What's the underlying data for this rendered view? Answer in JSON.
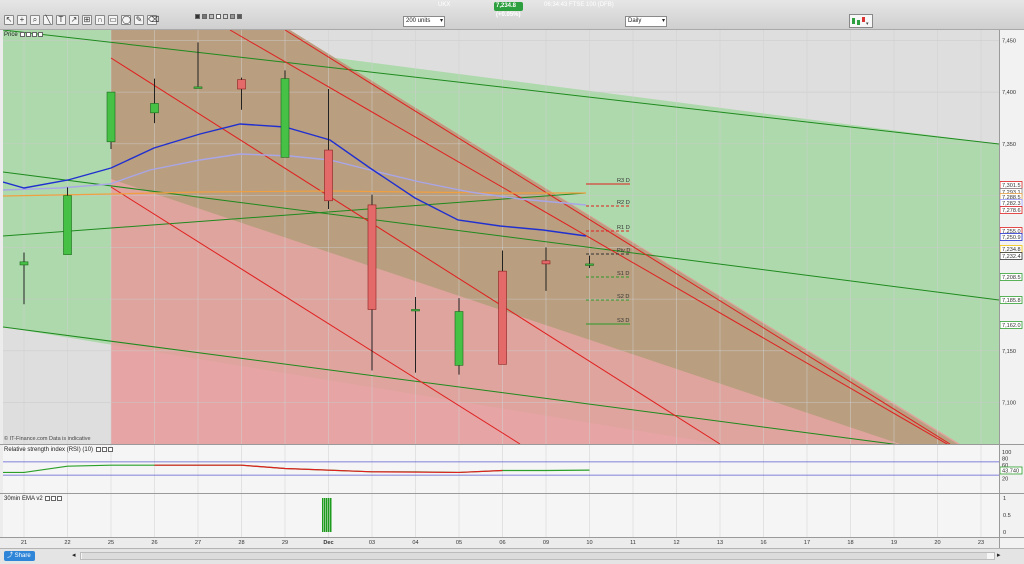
{
  "toolbar": {
    "ticker": "UKX",
    "price_change": "7,234.8 (+0.05%)",
    "time_info": "06:34:43 FTSE 100 (DFB)",
    "units_select": "200 units",
    "interval_select": "Daily",
    "tools": [
      "pointer-icon",
      "crosshair-icon",
      "zoom-icon",
      "line-icon",
      "text-icon",
      "trend-icon",
      "measure-icon",
      "magnet-icon",
      "rect-icon",
      "ellipse-icon",
      "draw-icon",
      "eraser-icon"
    ],
    "swatches": [
      "#333333",
      "#777777",
      "#bbbbbb",
      "#ffffff",
      "#d9d9d9",
      "#9a9a9a",
      "#5a5a5a"
    ]
  },
  "price_panel": {
    "title": "Price",
    "footer": "© IT-Finance.com  Data is indicative",
    "y_ticks": [
      "7,450",
      "7,400",
      "7,350",
      "7,300",
      "7,250",
      "7,200",
      "7,150",
      "7,100"
    ],
    "price_tags": [
      {
        "label": "7,301.5",
        "color": "#e02020"
      },
      {
        "label": "7,293.1",
        "color": "#888888"
      },
      {
        "label": "7,288.5",
        "color": "#e8a040"
      },
      {
        "label": "7,282.3",
        "color": "#9999ff"
      },
      {
        "label": "7,278.6",
        "color": "#e02020"
      },
      {
        "label": "7,255.0",
        "color": "#e02020"
      },
      {
        "label": "7,250.9",
        "color": "#2030d0"
      },
      {
        "label": "7,234.8",
        "color": "#f2c200"
      },
      {
        "label": "7,232.4",
        "color": "#333333"
      },
      {
        "label": "7,208.5",
        "color": "#30a030"
      },
      {
        "label": "7,185.8",
        "color": "#30a030"
      },
      {
        "label": "7,162.0",
        "color": "#30a030"
      }
    ],
    "pivots": [
      {
        "label": "R3 D",
        "color": "#e02020"
      },
      {
        "label": "R2 D",
        "color": "#e02020"
      },
      {
        "label": "R1 D",
        "color": "#e02020"
      },
      {
        "label": "Piv D",
        "color": "#333333"
      },
      {
        "label": "S1 D",
        "color": "#2a9a2a"
      },
      {
        "label": "S2 D",
        "color": "#2a9a2a"
      },
      {
        "label": "S3 D",
        "color": "#2a9a2a"
      }
    ]
  },
  "rsi_panel": {
    "title": "Relative strength index (RSI) (10)",
    "y_ticks": [
      "100",
      "80",
      "60",
      "40",
      "20"
    ],
    "current": "43.740"
  },
  "ema_panel": {
    "title": "30min EMA v2",
    "y_ticks": [
      "1",
      "0.5",
      "0"
    ]
  },
  "x_axis": [
    "21",
    "22",
    "25",
    "26",
    "27",
    "28",
    "29",
    "Dec",
    "03",
    "04",
    "05",
    "06",
    "09",
    "10",
    "11",
    "12",
    "13",
    "16",
    "17",
    "18",
    "19",
    "20",
    "23"
  ],
  "bottom": {
    "share": "Share"
  },
  "chart_data": {
    "type": "candlestick",
    "interval": "Daily",
    "ylim": [
      7060,
      7460
    ],
    "dates": [
      "21",
      "22",
      "25",
      "26",
      "27",
      "28",
      "29",
      "Dec",
      "03",
      "04",
      "05",
      "06",
      "09",
      "10"
    ],
    "ohlc": [
      [
        7233,
        7245,
        7195,
        7236
      ],
      [
        7243,
        7308,
        7243,
        7300
      ],
      [
        7352,
        7400,
        7345,
        7400
      ],
      [
        7380,
        7413,
        7370,
        7389
      ],
      [
        7405,
        7448,
        7405,
        7405
      ],
      [
        7412,
        7414,
        7383,
        7403
      ],
      [
        7337,
        7421,
        7337,
        7413
      ],
      [
        7344,
        7403,
        7287,
        7295
      ],
      [
        7291,
        7301,
        7131,
        7190
      ],
      [
        7190,
        7202,
        7129,
        7190
      ],
      [
        7136,
        7201,
        7127,
        7188
      ],
      [
        7227,
        7247,
        7137,
        7137
      ],
      [
        7237,
        7250,
        7208,
        7234
      ],
      [
        7234,
        7242,
        7230,
        7234
      ]
    ],
    "rsi": [
      38,
      57,
      60,
      60,
      60,
      60,
      50,
      45,
      40,
      40,
      38,
      44,
      44,
      45
    ]
  }
}
